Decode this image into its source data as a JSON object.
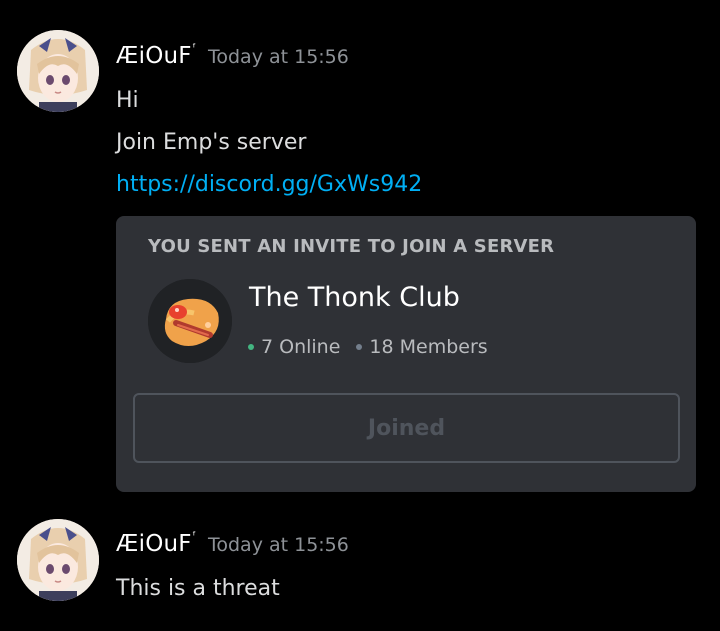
{
  "messages": [
    {
      "username": "ÆiOuF",
      "username_sup": "ᶠ",
      "timestamp": "Today at 15:56",
      "lines": [
        "Hi",
        "Join Emp's server"
      ],
      "link": "https://discord.gg/GxWs942"
    },
    {
      "username": "ÆiOuF",
      "username_sup": "ᶠ",
      "timestamp": "Today at 15:56",
      "lines": [
        "This is a threat"
      ]
    }
  ],
  "invite": {
    "title": "YOU SENT AN INVITE TO JOIN A SERVER",
    "server_name": "The Thonk Club",
    "online": "7 Online",
    "members": "18 Members",
    "button_label": "Joined"
  },
  "icons": {
    "avatar": "anime-girl-avatar",
    "server": "thonk-emoji-icon"
  },
  "colors": {
    "background": "#000000",
    "embed_background": "#2f3136",
    "link": "#00aff4",
    "online_dot": "#43b581",
    "timestamp": "#8e9297"
  }
}
